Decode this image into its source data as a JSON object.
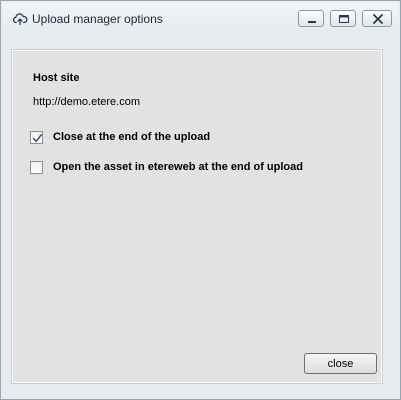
{
  "window": {
    "title": "Upload manager options",
    "title_icon": "cloud-upload-icon",
    "controls": {
      "minimize_icon": "minimize-icon",
      "maximize_icon": "maximize-icon",
      "close_icon": "close-icon"
    }
  },
  "host": {
    "label": "Host site",
    "url": "http://demo.etere.com"
  },
  "options": [
    {
      "label": "Close at the end of the upload",
      "checked": true
    },
    {
      "label": "Open the asset in etereweb at the end of upload",
      "checked": false
    }
  ],
  "footer": {
    "close_label": "close"
  },
  "colors": {
    "window_border": "#9aa6b4",
    "panel_background": "#e2e2e2",
    "checkmark": "#4a5a6e"
  }
}
